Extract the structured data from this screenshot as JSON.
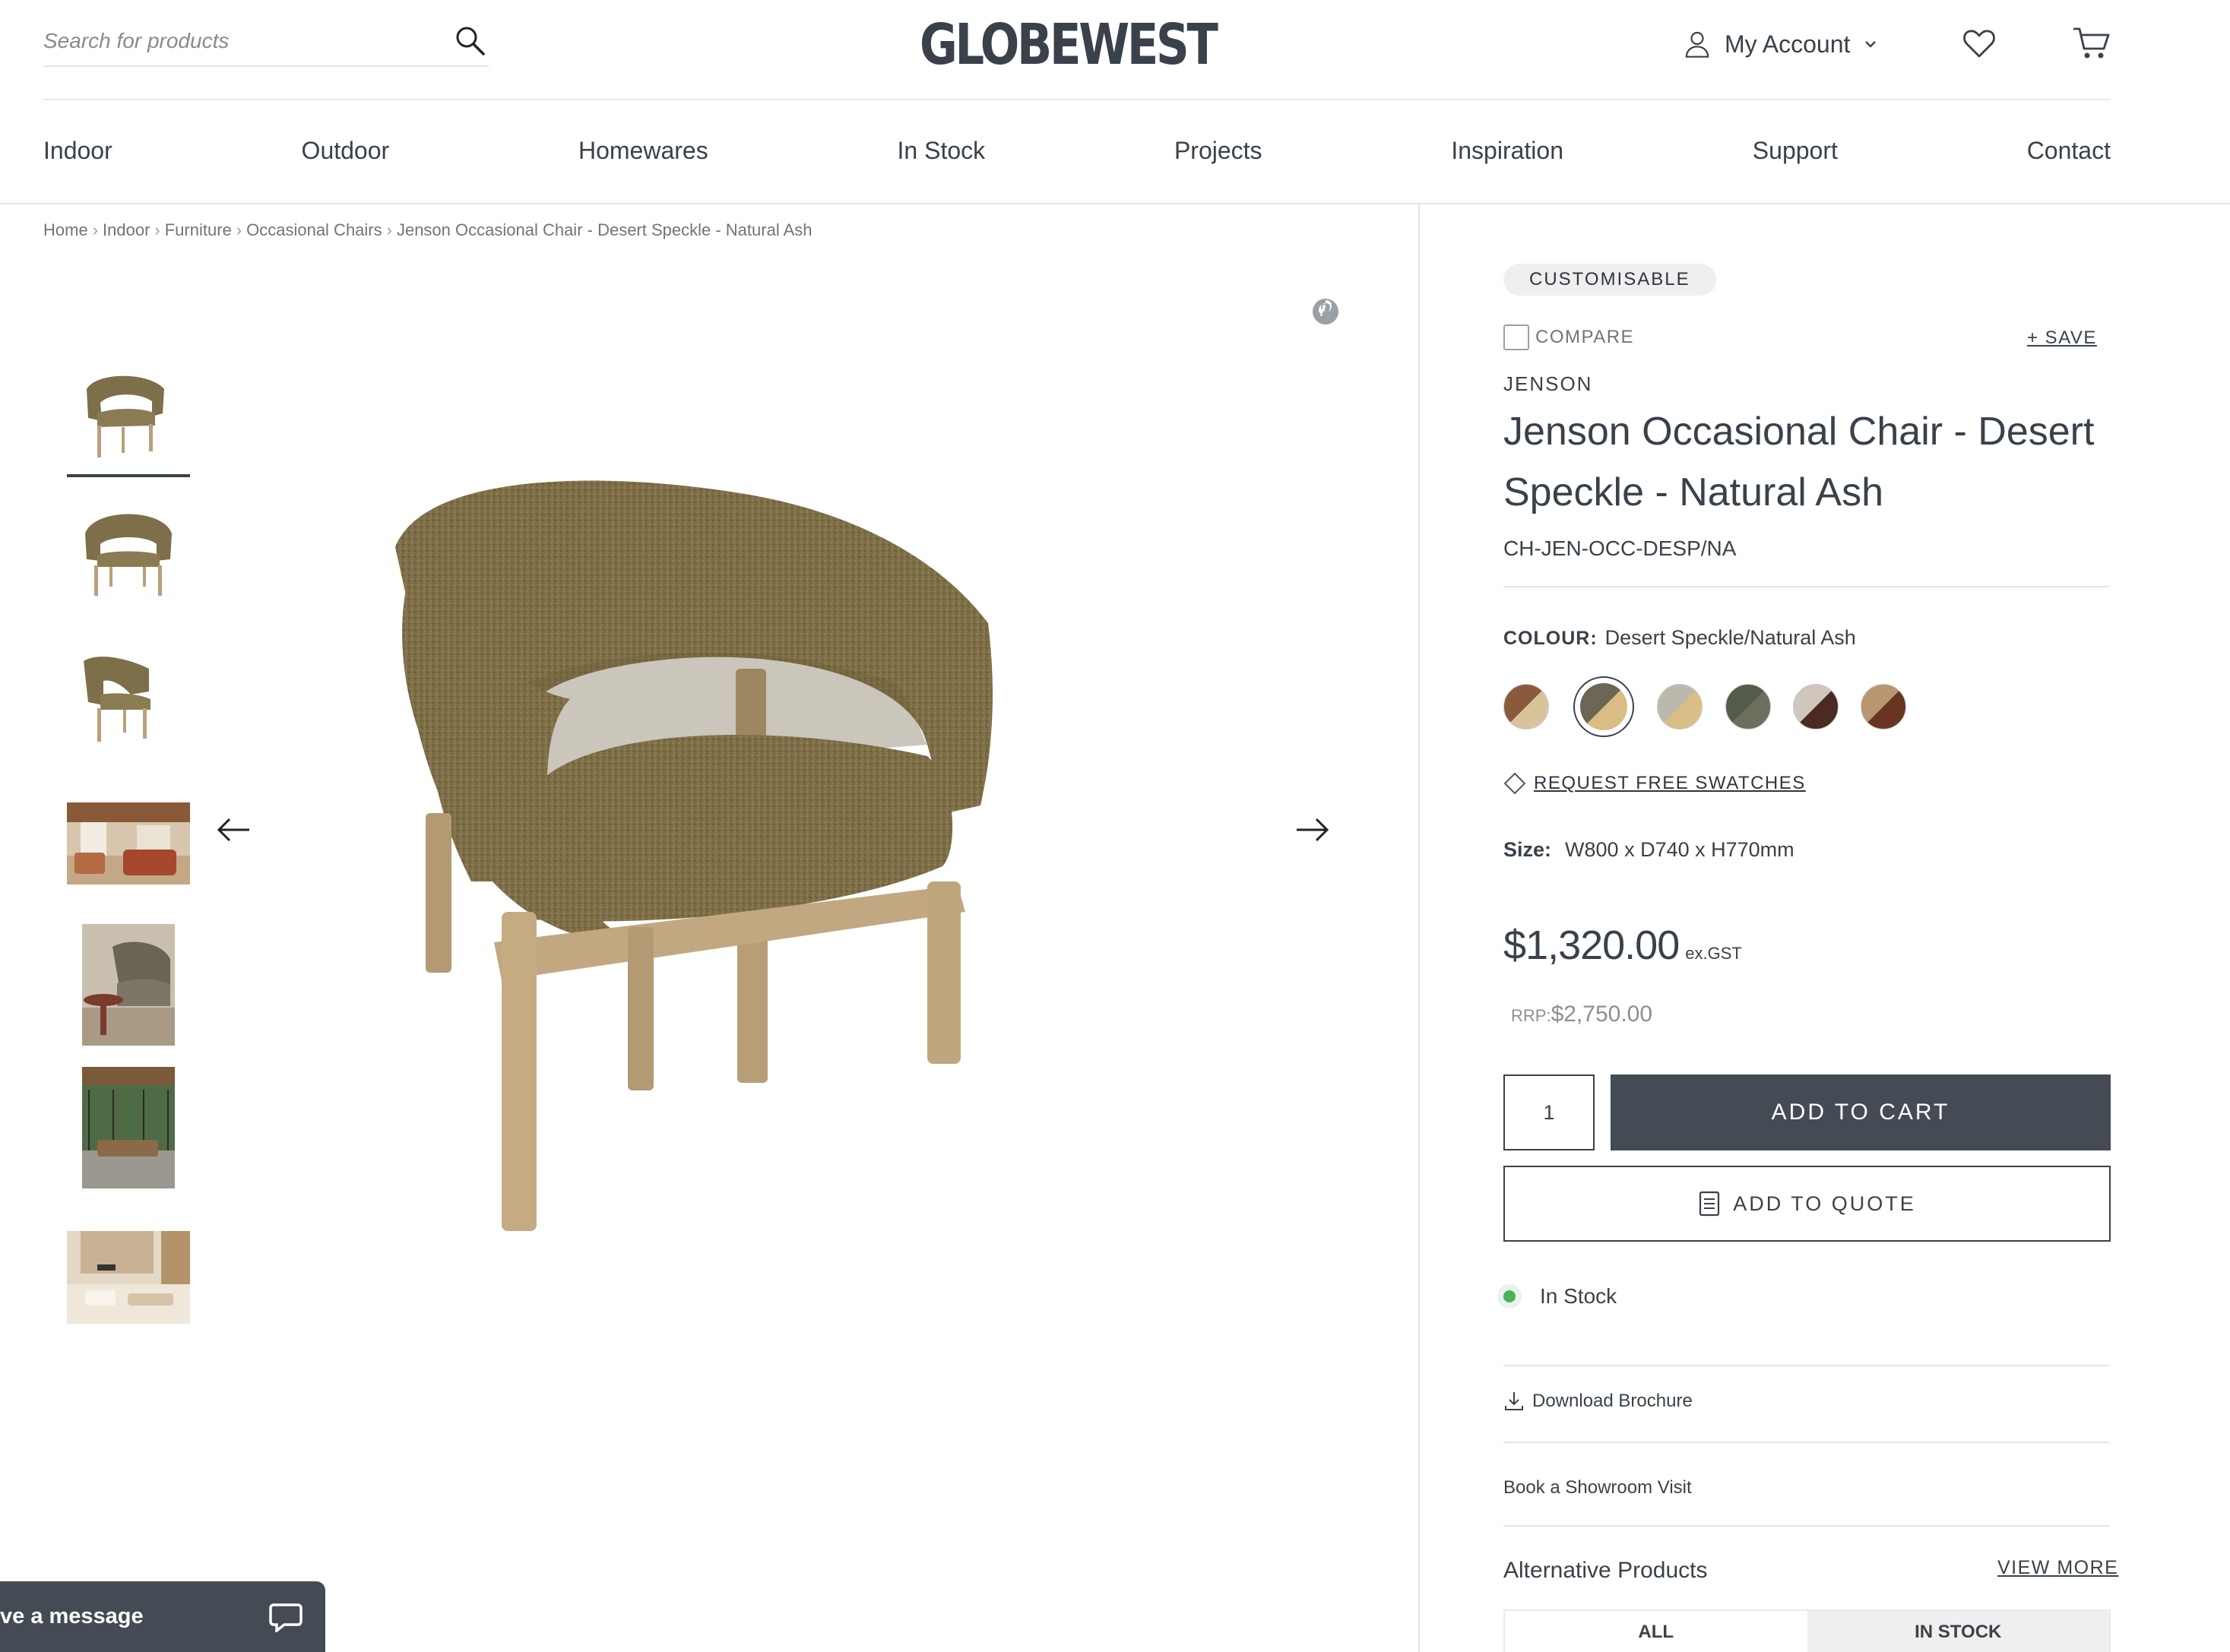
{
  "header": {
    "search_placeholder": "Search for products",
    "logo": "GLOBEWEST",
    "account_label": "My Account"
  },
  "nav": [
    "Indoor",
    "Outdoor",
    "Homewares",
    "In Stock",
    "Projects",
    "Inspiration",
    "Support",
    "Contact"
  ],
  "breadcrumb": [
    "Home",
    "Indoor",
    "Furniture",
    "Occasional Chairs",
    "Jenson Occasional Chair - Desert Speckle - Natural Ash"
  ],
  "product": {
    "badge": "CUSTOMISABLE",
    "compare_label": "COMPARE",
    "save_label": "+ SAVE",
    "brand": "JENSON",
    "title": "Jenson Occasional Chair - Desert Speckle - Natural Ash",
    "sku": "CH-JEN-OCC-DESP/NA",
    "colour_label": "COLOUR:",
    "colour_value": "Desert Speckle/Natural Ash",
    "swatches": [
      {
        "name": "swatch-1",
        "colors": [
          "#8a5a3c",
          "#d9c39a"
        ],
        "selected": false
      },
      {
        "name": "swatch-desert-speckle",
        "colors": [
          "#6d6656",
          "#d8bd84"
        ],
        "selected": true
      },
      {
        "name": "swatch-3",
        "colors": [
          "#bdb8ad",
          "#d9bf85"
        ],
        "selected": false
      },
      {
        "name": "swatch-4",
        "colors": [
          "#555b4a",
          "#6a705d"
        ],
        "selected": false
      },
      {
        "name": "swatch-5",
        "colors": [
          "#cfc7bd",
          "#4a2a22"
        ],
        "selected": false
      },
      {
        "name": "swatch-6",
        "colors": [
          "#b89670",
          "#6a3422"
        ],
        "selected": false
      }
    ],
    "request_swatches": "REQUEST FREE SWATCHES",
    "size_label": "Size:",
    "size_value": "W800 x D740 x H770mm",
    "price": "$1,320.00",
    "price_suffix": "ex.GST",
    "rrp_label": "RRP:",
    "rrp_value": "$2,750.00",
    "quantity": "1",
    "add_to_cart": "ADD TO CART",
    "add_to_quote": "ADD TO QUOTE",
    "stock_status": "In Stock",
    "download_brochure": "Download Brochure",
    "book_showroom": "Book a Showroom Visit",
    "alternative_title": "Alternative Products",
    "view_more": "VIEW MORE",
    "tab_all": "ALL",
    "tab_in_stock": "IN STOCK"
  },
  "chat": {
    "label": "ve a message"
  },
  "colors": {
    "primary": "#444b54",
    "text": "#39414a",
    "stock": "#4caf5b"
  }
}
